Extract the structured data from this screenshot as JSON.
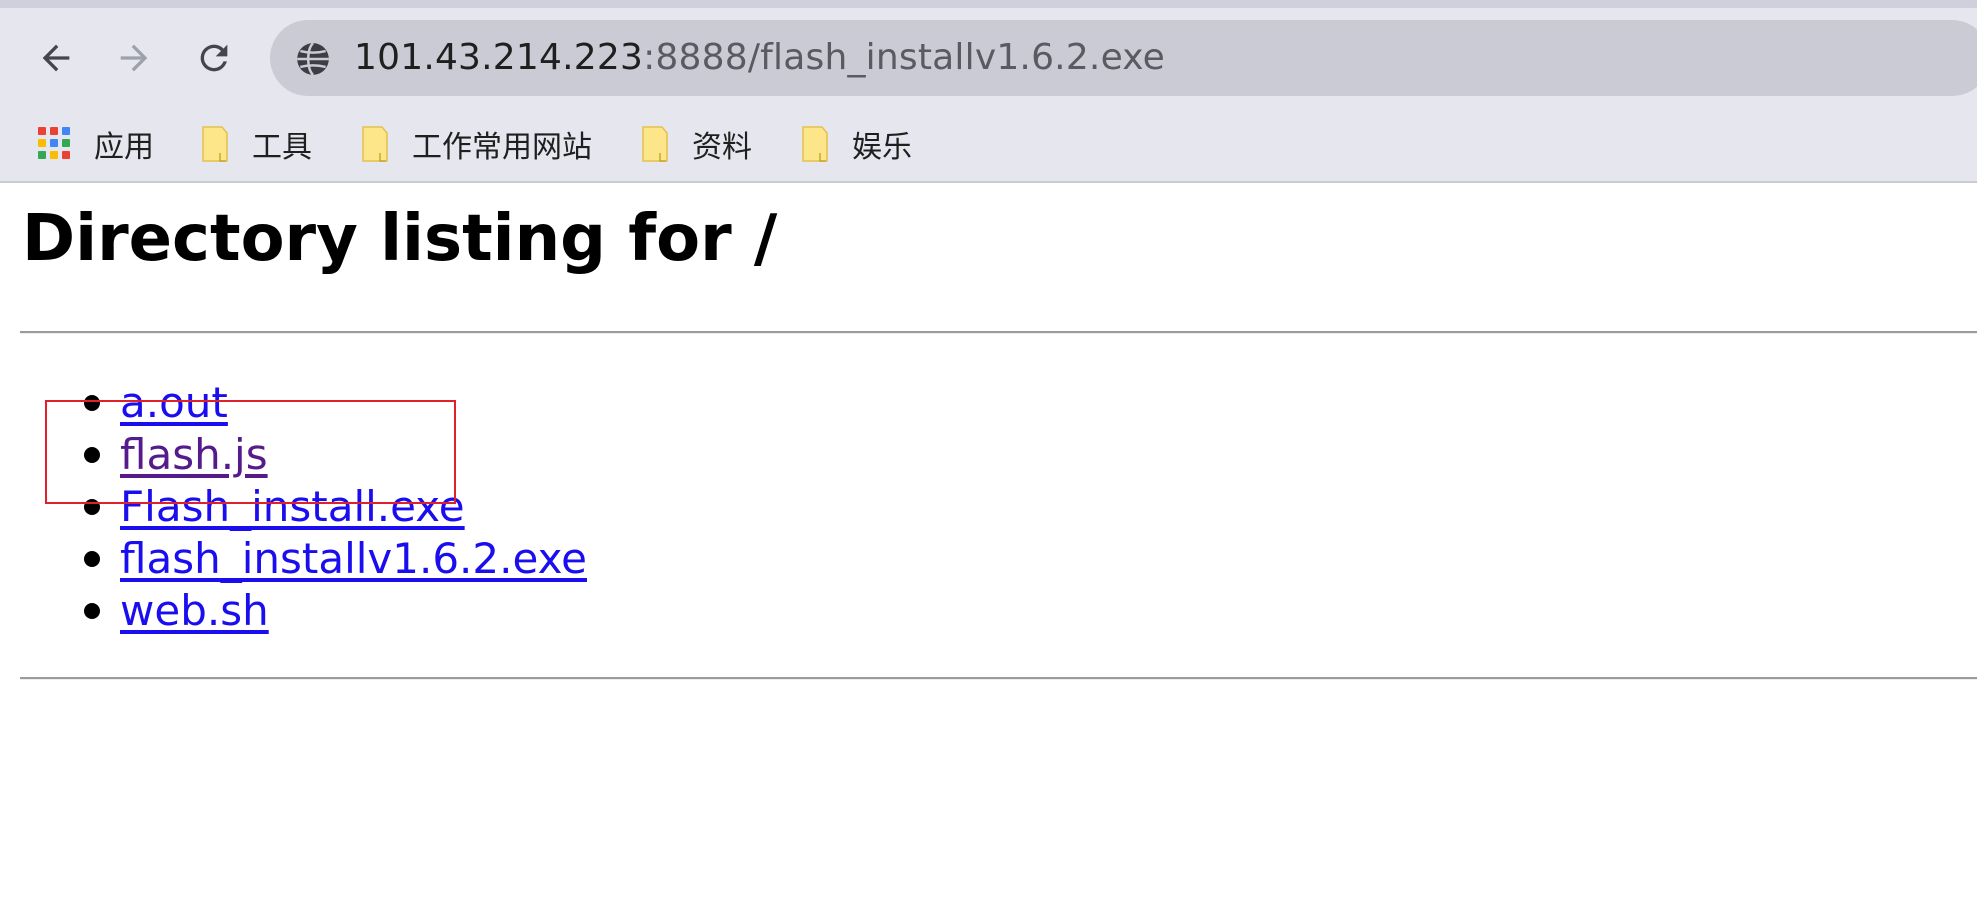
{
  "browser": {
    "nav": {
      "back_icon": "arrow-left-icon",
      "forward_icon": "arrow-right-icon",
      "reload_icon": "reload-icon"
    },
    "address_bar": {
      "security_icon": "globe-icon",
      "host": "101.43.214.223",
      "rest": ":8888/flash_installv1.6.2.exe"
    },
    "bookmarks": [
      {
        "label": "应用",
        "icon": "apps-grid-icon"
      },
      {
        "label": "工具",
        "icon": "folder-icon"
      },
      {
        "label": "工作常用网站",
        "icon": "folder-icon"
      },
      {
        "label": "资料",
        "icon": "folder-icon"
      },
      {
        "label": "娱乐",
        "icon": "folder-icon"
      }
    ]
  },
  "page": {
    "title": "Directory listing for /",
    "files": [
      {
        "name": "a.out",
        "visited": false
      },
      {
        "name": "flash.js",
        "visited": true
      },
      {
        "name": "Flash_install.exe",
        "visited": false
      },
      {
        "name": "flash_installv1.6.2.exe",
        "visited": false
      },
      {
        "name": "web.sh",
        "visited": false
      }
    ]
  },
  "colors": {
    "link": "#1a0dee",
    "visited_link": "#551a8b",
    "annotation_box": "#e0212b",
    "toolbar_bg": "#e6e7ee",
    "omnibox_bg": "#cbcbd5"
  }
}
